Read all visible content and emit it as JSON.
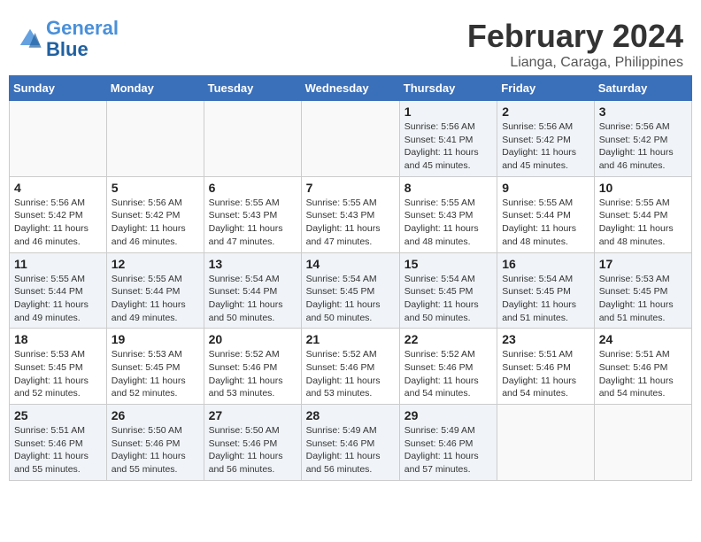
{
  "header": {
    "logo_line1": "General",
    "logo_line2": "Blue",
    "title": "February 2024",
    "location": "Lianga, Caraga, Philippines"
  },
  "columns": [
    "Sunday",
    "Monday",
    "Tuesday",
    "Wednesday",
    "Thursday",
    "Friday",
    "Saturday"
  ],
  "weeks": [
    [
      {
        "day": "",
        "info": ""
      },
      {
        "day": "",
        "info": ""
      },
      {
        "day": "",
        "info": ""
      },
      {
        "day": "",
        "info": ""
      },
      {
        "day": "1",
        "info": "Sunrise: 5:56 AM\nSunset: 5:41 PM\nDaylight: 11 hours\nand 45 minutes."
      },
      {
        "day": "2",
        "info": "Sunrise: 5:56 AM\nSunset: 5:42 PM\nDaylight: 11 hours\nand 45 minutes."
      },
      {
        "day": "3",
        "info": "Sunrise: 5:56 AM\nSunset: 5:42 PM\nDaylight: 11 hours\nand 46 minutes."
      }
    ],
    [
      {
        "day": "4",
        "info": "Sunrise: 5:56 AM\nSunset: 5:42 PM\nDaylight: 11 hours\nand 46 minutes."
      },
      {
        "day": "5",
        "info": "Sunrise: 5:56 AM\nSunset: 5:42 PM\nDaylight: 11 hours\nand 46 minutes."
      },
      {
        "day": "6",
        "info": "Sunrise: 5:55 AM\nSunset: 5:43 PM\nDaylight: 11 hours\nand 47 minutes."
      },
      {
        "day": "7",
        "info": "Sunrise: 5:55 AM\nSunset: 5:43 PM\nDaylight: 11 hours\nand 47 minutes."
      },
      {
        "day": "8",
        "info": "Sunrise: 5:55 AM\nSunset: 5:43 PM\nDaylight: 11 hours\nand 48 minutes."
      },
      {
        "day": "9",
        "info": "Sunrise: 5:55 AM\nSunset: 5:44 PM\nDaylight: 11 hours\nand 48 minutes."
      },
      {
        "day": "10",
        "info": "Sunrise: 5:55 AM\nSunset: 5:44 PM\nDaylight: 11 hours\nand 48 minutes."
      }
    ],
    [
      {
        "day": "11",
        "info": "Sunrise: 5:55 AM\nSunset: 5:44 PM\nDaylight: 11 hours\nand 49 minutes."
      },
      {
        "day": "12",
        "info": "Sunrise: 5:55 AM\nSunset: 5:44 PM\nDaylight: 11 hours\nand 49 minutes."
      },
      {
        "day": "13",
        "info": "Sunrise: 5:54 AM\nSunset: 5:44 PM\nDaylight: 11 hours\nand 50 minutes."
      },
      {
        "day": "14",
        "info": "Sunrise: 5:54 AM\nSunset: 5:45 PM\nDaylight: 11 hours\nand 50 minutes."
      },
      {
        "day": "15",
        "info": "Sunrise: 5:54 AM\nSunset: 5:45 PM\nDaylight: 11 hours\nand 50 minutes."
      },
      {
        "day": "16",
        "info": "Sunrise: 5:54 AM\nSunset: 5:45 PM\nDaylight: 11 hours\nand 51 minutes."
      },
      {
        "day": "17",
        "info": "Sunrise: 5:53 AM\nSunset: 5:45 PM\nDaylight: 11 hours\nand 51 minutes."
      }
    ],
    [
      {
        "day": "18",
        "info": "Sunrise: 5:53 AM\nSunset: 5:45 PM\nDaylight: 11 hours\nand 52 minutes."
      },
      {
        "day": "19",
        "info": "Sunrise: 5:53 AM\nSunset: 5:45 PM\nDaylight: 11 hours\nand 52 minutes."
      },
      {
        "day": "20",
        "info": "Sunrise: 5:52 AM\nSunset: 5:46 PM\nDaylight: 11 hours\nand 53 minutes."
      },
      {
        "day": "21",
        "info": "Sunrise: 5:52 AM\nSunset: 5:46 PM\nDaylight: 11 hours\nand 53 minutes."
      },
      {
        "day": "22",
        "info": "Sunrise: 5:52 AM\nSunset: 5:46 PM\nDaylight: 11 hours\nand 54 minutes."
      },
      {
        "day": "23",
        "info": "Sunrise: 5:51 AM\nSunset: 5:46 PM\nDaylight: 11 hours\nand 54 minutes."
      },
      {
        "day": "24",
        "info": "Sunrise: 5:51 AM\nSunset: 5:46 PM\nDaylight: 11 hours\nand 54 minutes."
      }
    ],
    [
      {
        "day": "25",
        "info": "Sunrise: 5:51 AM\nSunset: 5:46 PM\nDaylight: 11 hours\nand 55 minutes."
      },
      {
        "day": "26",
        "info": "Sunrise: 5:50 AM\nSunset: 5:46 PM\nDaylight: 11 hours\nand 55 minutes."
      },
      {
        "day": "27",
        "info": "Sunrise: 5:50 AM\nSunset: 5:46 PM\nDaylight: 11 hours\nand 56 minutes."
      },
      {
        "day": "28",
        "info": "Sunrise: 5:49 AM\nSunset: 5:46 PM\nDaylight: 11 hours\nand 56 minutes."
      },
      {
        "day": "29",
        "info": "Sunrise: 5:49 AM\nSunset: 5:46 PM\nDaylight: 11 hours\nand 57 minutes."
      },
      {
        "day": "",
        "info": ""
      },
      {
        "day": "",
        "info": ""
      }
    ]
  ]
}
